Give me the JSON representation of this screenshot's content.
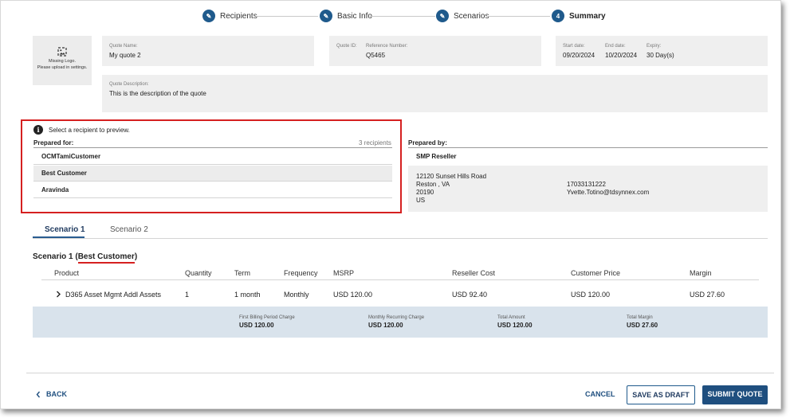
{
  "stepper": {
    "steps": [
      {
        "label": "Recipients",
        "badge": "✎"
      },
      {
        "label": "Basic Info",
        "badge": "✎"
      },
      {
        "label": "Scenarios",
        "badge": "✎"
      },
      {
        "label": "Summary",
        "badge": "4"
      }
    ]
  },
  "logo": {
    "line1": "Missing Logo.",
    "line2": "Please upload in settings."
  },
  "quote": {
    "name_label": "Quote Name:",
    "name": "My quote 2",
    "id_label": "Quote ID:",
    "id": "",
    "ref_label": "Reference Number:",
    "ref": "Q5465",
    "start_label": "Start date:",
    "start": "09/20/2024",
    "end_label": "End date:",
    "end": "10/20/2024",
    "expiry_label": "Expiry:",
    "expiry": "30 Day(s)",
    "desc_label": "Quote Description:",
    "desc": "This is the description of the quote"
  },
  "preview": {
    "info": "Select a recipient to preview.",
    "prepared_for_label": "Prepared for:",
    "recipient_count": "3 recipients",
    "recipients": [
      "OCMTamiCustomer",
      "Best Customer",
      "Aravinda"
    ]
  },
  "prepared_by": {
    "label": "Prepared by:",
    "company": "SMP Reseller",
    "address1": "12120 Sunset Hills Road",
    "address2": "Reston , VA",
    "zip": "20190",
    "country": "US",
    "phone": "17033131222",
    "email": "Yvette.Totino@tdsynnex.com"
  },
  "tabs": [
    "Scenario 1",
    "Scenario 2"
  ],
  "scenario": {
    "title_prefix": "Scenario 1 (",
    "customer": "Best Customer",
    "title_suffix": ")"
  },
  "table": {
    "headers": [
      "Product",
      "Quantity",
      "Term",
      "Frequency",
      "MSRP",
      "Reseller Cost",
      "Customer Price",
      "Margin"
    ],
    "row": {
      "product": "D365 Asset Mgmt Addl Assets",
      "quantity": "1",
      "term": "1 month",
      "frequency": "Monthly",
      "msrp": "USD 120.00",
      "reseller_cost": "USD 92.40",
      "customer_price": "USD 120.00",
      "margin": "USD 27.60"
    }
  },
  "summary": {
    "first_label": "First Billing Period Charge",
    "first": "USD 120.00",
    "monthly_label": "Monthly Recurring Charge",
    "monthly": "USD 120.00",
    "total_label": "Total Amount",
    "total": "USD 120.00",
    "margin_label": "Total Margin",
    "margin": "USD 27.60"
  },
  "footer": {
    "back": "BACK",
    "cancel": "CANCEL",
    "save_draft": "SAVE AS DRAFT",
    "submit": "SUBMIT QUOTE"
  },
  "colors": {
    "accent": "#1f4f7f",
    "highlight": "#d52020",
    "summary_bg": "#d9e3ec"
  }
}
